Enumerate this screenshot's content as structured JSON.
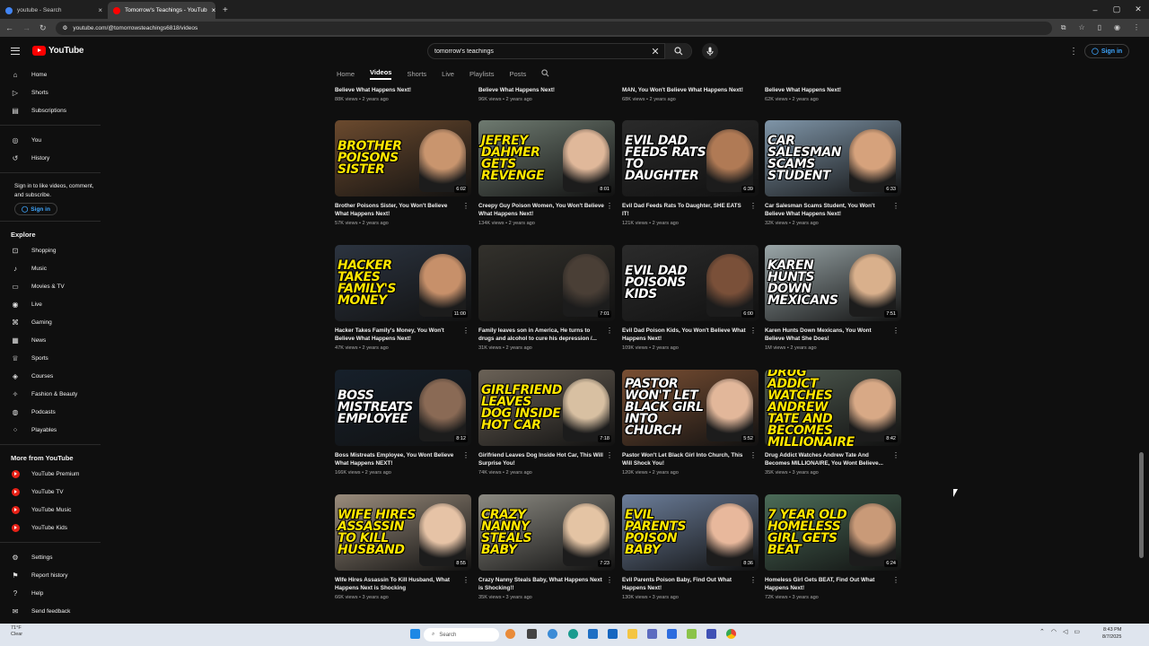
{
  "browser": {
    "tabs": [
      {
        "title": "youtube - Search",
        "active": false
      },
      {
        "title": "Tomorrow's Teachings - YouTub",
        "active": true
      }
    ],
    "url": "youtube.com/@tomorrowsteachings6818/videos"
  },
  "header": {
    "logo": "YouTube",
    "search_value": "tomorrow's teachings",
    "sign_in": "Sign in"
  },
  "sidebar": {
    "main": [
      {
        "label": "Home",
        "icon": "home-icon"
      },
      {
        "label": "Shorts",
        "icon": "shorts-icon"
      },
      {
        "label": "Subscriptions",
        "icon": "subscriptions-icon"
      }
    ],
    "you": [
      {
        "label": "You",
        "icon": "you-icon"
      },
      {
        "label": "History",
        "icon": "history-icon"
      }
    ],
    "signin_note": "Sign in to like videos, comment, and subscribe.",
    "signin_button": "Sign in",
    "explore_title": "Explore",
    "explore": [
      {
        "label": "Shopping",
        "icon": "shopping-icon"
      },
      {
        "label": "Music",
        "icon": "music-icon"
      },
      {
        "label": "Movies & TV",
        "icon": "movies-icon"
      },
      {
        "label": "Live",
        "icon": "live-icon"
      },
      {
        "label": "Gaming",
        "icon": "gaming-icon"
      },
      {
        "label": "News",
        "icon": "news-icon"
      },
      {
        "label": "Sports",
        "icon": "sports-icon"
      },
      {
        "label": "Courses",
        "icon": "courses-icon"
      },
      {
        "label": "Fashion & Beauty",
        "icon": "fashion-icon"
      },
      {
        "label": "Podcasts",
        "icon": "podcasts-icon"
      },
      {
        "label": "Playables",
        "icon": "playables-icon"
      }
    ],
    "more_title": "More from YouTube",
    "more": [
      {
        "label": "YouTube Premium"
      },
      {
        "label": "YouTube TV"
      },
      {
        "label": "YouTube Music"
      },
      {
        "label": "YouTube Kids"
      }
    ],
    "bottom": [
      {
        "label": "Settings",
        "icon": "settings-icon"
      },
      {
        "label": "Report history",
        "icon": "flag-icon"
      },
      {
        "label": "Help",
        "icon": "help-icon"
      },
      {
        "label": "Send feedback",
        "icon": "feedback-icon"
      }
    ]
  },
  "channel_tabs": [
    "Home",
    "Videos",
    "Shorts",
    "Live",
    "Playlists",
    "Posts"
  ],
  "active_tab": "Videos",
  "previous_row": [
    {
      "title": "Believe What Happens Next!",
      "meta": "88K views • 2 years ago"
    },
    {
      "title": "Believe What Happens Next!",
      "meta": "96K views • 2 years ago"
    },
    {
      "title": "MAN, You Won't Believe What Happens Next!",
      "meta": "68K views • 2 years ago"
    },
    {
      "title": "Believe What Happens Next!",
      "meta": "62K views • 2 years ago"
    }
  ],
  "videos": [
    [
      {
        "thumb_text": "Brother Poisons Sister",
        "duration": "6:02",
        "title": "Brother Poisons Sister, You Won't Believe What Happens Next!",
        "meta": "57K views • 2 years ago",
        "bg": "#6b4a2e",
        "text_color": "#ffe600",
        "face": "#c9956e"
      },
      {
        "thumb_text": "Jefrey Dahmer Gets Revenge",
        "duration": "8:01",
        "title": "Creepy Guy Poison Women, You Won't Believe What Happens Next!",
        "meta": "134K views • 2 years ago",
        "bg": "#6e7a70",
        "text_color": "#ffe600",
        "face": "#e0b89a"
      },
      {
        "thumb_text": "Evil Dad Feeds Rats To Daughter",
        "duration": "6:39",
        "title": "Evil Dad Feeds Rats To Daughter, SHE EATS IT!",
        "meta": "121K views • 2 years ago",
        "bg": "#2a2a2a",
        "text_color": "#ffffff",
        "face": "#b07a55"
      },
      {
        "thumb_text": "Car Salesman Scams Student",
        "duration": "6:33",
        "title": "Car Salesman Scams Student, You Won't Believe What Happens Next!",
        "meta": "32K views • 2 years ago",
        "bg": "#7f95a8",
        "text_color": "#ffffff",
        "face": "#d6a27c"
      }
    ],
    [
      {
        "thumb_text": "Hacker Takes Family's Money",
        "duration": "11:00",
        "title": "Hacker Takes Family's Money, You Won't Believe What Happens Next!",
        "meta": "47K views • 2 years ago",
        "bg": "#2c3440",
        "text_color": "#ffe600",
        "face": "#c7906a"
      },
      {
        "thumb_text": "",
        "duration": "7:01",
        "title": "Family leaves son in America, He turns to drugs and alcohol to cure his depression /...",
        "meta": "31K views • 2 years ago",
        "bg": "#33312c",
        "text_color": "#ffffff",
        "face": "#4a3f36"
      },
      {
        "thumb_text": "Evil Dad Poisons Kids",
        "duration": "6:00",
        "title": "Evil Dad Poison Kids, You Won't Believe What Happens Next!",
        "meta": "109K views • 2 years ago",
        "bg": "#2b2b2b",
        "text_color": "#ffffff",
        "face": "#7a5039"
      },
      {
        "thumb_text": "Karen Hunts Down Mexicans",
        "duration": "7:51",
        "title": "Karen Hunts Down Mexicans, You Wont Believe What She Does!",
        "meta": "1M views • 2 years ago",
        "bg": "#9aa6a8",
        "text_color": "#ffffff",
        "face": "#d9b08c"
      }
    ],
    [
      {
        "thumb_text": "Boss Mistreats Employee",
        "duration": "8:12",
        "title": "Boss Mistreats Employee, You Wont Believe What Happens NEXT!",
        "meta": "166K views • 2 years ago",
        "bg": "#16202b",
        "text_color": "#ffffff",
        "face": "#8a6a55"
      },
      {
        "thumb_text": "Girlfriend Leaves Dog Inside Hot Car",
        "duration": "7:18",
        "title": "Girlfriend Leaves Dog Inside Hot Car, This Will Surprise You!",
        "meta": "74K views • 2 years ago",
        "bg": "#6b6257",
        "text_color": "#ffe600",
        "face": "#d8c0a2"
      },
      {
        "thumb_text": "Pastor Won't Let Black Girl Into Church",
        "duration": "5:52",
        "title": "Pastor Won't Let Black Girl Into Church, This Will Shock You!",
        "meta": "120K views • 2 years ago",
        "bg": "#7a4f33",
        "text_color": "#ffffff",
        "face": "#e2b79a"
      },
      {
        "thumb_text": "Drug Addict Watches Andrew Tate And Becomes Millionaire",
        "duration": "8:42",
        "title": "Drug Addict Watches Andrew Tate And Becomes MILLIONAIRE, You Wont Believe...",
        "meta": "35K views • 3 years ago",
        "bg": "#4f5a50",
        "text_color": "#ffe600",
        "face": "#d8a986"
      }
    ],
    [
      {
        "thumb_text": "Wife Hires Assassin To Kill Husband",
        "duration": "8:55",
        "title": "Wife Hires Assassin To Kill Husband, What Happens Next is Shocking",
        "meta": "66K views • 3 years ago",
        "bg": "#9a8c7c",
        "text_color": "#ffe600",
        "face": "#e6c3a6"
      },
      {
        "thumb_text": "Crazy Nanny Steals Baby",
        "duration": "7:23",
        "title": "Crazy Nanny Steals Baby, What Happens Next is Shocking!!",
        "meta": "35K views • 3 years ago",
        "bg": "#8c8a82",
        "text_color": "#ffe600",
        "face": "#e4c4a4"
      },
      {
        "thumb_text": "Evil Parents Poison Baby",
        "duration": "8:36",
        "title": "Evil Parents Poison Baby, Find Out What Happens Next!",
        "meta": "130K views • 3 years ago",
        "bg": "#6c7e9a",
        "text_color": "#ffe600",
        "face": "#e8b89c"
      },
      {
        "thumb_text": "7 Year Old Homeless Girl Gets Beat",
        "duration": "6:24",
        "title": "Homeless Girl Gets BEAT, Find Out What Happens Next!",
        "meta": "72K views • 3 years ago",
        "bg": "#4b6b58",
        "text_color": "#ffe600",
        "face": "#c99a78"
      }
    ]
  ],
  "taskbar": {
    "weather_temp": "71°F",
    "weather_desc": "Clear",
    "search": "Search",
    "time": "8:43 PM",
    "date": "8/7/2025"
  }
}
